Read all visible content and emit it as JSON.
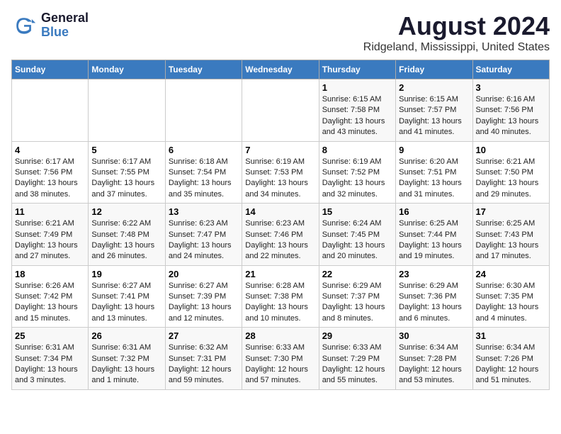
{
  "logo": {
    "line1": "General",
    "line2": "Blue"
  },
  "title": "August 2024",
  "subtitle": "Ridgeland, Mississippi, United States",
  "days_of_week": [
    "Sunday",
    "Monday",
    "Tuesday",
    "Wednesday",
    "Thursday",
    "Friday",
    "Saturday"
  ],
  "weeks": [
    [
      {
        "day": "",
        "info": ""
      },
      {
        "day": "",
        "info": ""
      },
      {
        "day": "",
        "info": ""
      },
      {
        "day": "",
        "info": ""
      },
      {
        "day": "1",
        "info": "Sunrise: 6:15 AM\nSunset: 7:58 PM\nDaylight: 13 hours\nand 43 minutes."
      },
      {
        "day": "2",
        "info": "Sunrise: 6:15 AM\nSunset: 7:57 PM\nDaylight: 13 hours\nand 41 minutes."
      },
      {
        "day": "3",
        "info": "Sunrise: 6:16 AM\nSunset: 7:56 PM\nDaylight: 13 hours\nand 40 minutes."
      }
    ],
    [
      {
        "day": "4",
        "info": "Sunrise: 6:17 AM\nSunset: 7:56 PM\nDaylight: 13 hours\nand 38 minutes."
      },
      {
        "day": "5",
        "info": "Sunrise: 6:17 AM\nSunset: 7:55 PM\nDaylight: 13 hours\nand 37 minutes."
      },
      {
        "day": "6",
        "info": "Sunrise: 6:18 AM\nSunset: 7:54 PM\nDaylight: 13 hours\nand 35 minutes."
      },
      {
        "day": "7",
        "info": "Sunrise: 6:19 AM\nSunset: 7:53 PM\nDaylight: 13 hours\nand 34 minutes."
      },
      {
        "day": "8",
        "info": "Sunrise: 6:19 AM\nSunset: 7:52 PM\nDaylight: 13 hours\nand 32 minutes."
      },
      {
        "day": "9",
        "info": "Sunrise: 6:20 AM\nSunset: 7:51 PM\nDaylight: 13 hours\nand 31 minutes."
      },
      {
        "day": "10",
        "info": "Sunrise: 6:21 AM\nSunset: 7:50 PM\nDaylight: 13 hours\nand 29 minutes."
      }
    ],
    [
      {
        "day": "11",
        "info": "Sunrise: 6:21 AM\nSunset: 7:49 PM\nDaylight: 13 hours\nand 27 minutes."
      },
      {
        "day": "12",
        "info": "Sunrise: 6:22 AM\nSunset: 7:48 PM\nDaylight: 13 hours\nand 26 minutes."
      },
      {
        "day": "13",
        "info": "Sunrise: 6:23 AM\nSunset: 7:47 PM\nDaylight: 13 hours\nand 24 minutes."
      },
      {
        "day": "14",
        "info": "Sunrise: 6:23 AM\nSunset: 7:46 PM\nDaylight: 13 hours\nand 22 minutes."
      },
      {
        "day": "15",
        "info": "Sunrise: 6:24 AM\nSunset: 7:45 PM\nDaylight: 13 hours\nand 20 minutes."
      },
      {
        "day": "16",
        "info": "Sunrise: 6:25 AM\nSunset: 7:44 PM\nDaylight: 13 hours\nand 19 minutes."
      },
      {
        "day": "17",
        "info": "Sunrise: 6:25 AM\nSunset: 7:43 PM\nDaylight: 13 hours\nand 17 minutes."
      }
    ],
    [
      {
        "day": "18",
        "info": "Sunrise: 6:26 AM\nSunset: 7:42 PM\nDaylight: 13 hours\nand 15 minutes."
      },
      {
        "day": "19",
        "info": "Sunrise: 6:27 AM\nSunset: 7:41 PM\nDaylight: 13 hours\nand 13 minutes."
      },
      {
        "day": "20",
        "info": "Sunrise: 6:27 AM\nSunset: 7:39 PM\nDaylight: 13 hours\nand 12 minutes."
      },
      {
        "day": "21",
        "info": "Sunrise: 6:28 AM\nSunset: 7:38 PM\nDaylight: 13 hours\nand 10 minutes."
      },
      {
        "day": "22",
        "info": "Sunrise: 6:29 AM\nSunset: 7:37 PM\nDaylight: 13 hours\nand 8 minutes."
      },
      {
        "day": "23",
        "info": "Sunrise: 6:29 AM\nSunset: 7:36 PM\nDaylight: 13 hours\nand 6 minutes."
      },
      {
        "day": "24",
        "info": "Sunrise: 6:30 AM\nSunset: 7:35 PM\nDaylight: 13 hours\nand 4 minutes."
      }
    ],
    [
      {
        "day": "25",
        "info": "Sunrise: 6:31 AM\nSunset: 7:34 PM\nDaylight: 13 hours\nand 3 minutes."
      },
      {
        "day": "26",
        "info": "Sunrise: 6:31 AM\nSunset: 7:32 PM\nDaylight: 13 hours\nand 1 minute."
      },
      {
        "day": "27",
        "info": "Sunrise: 6:32 AM\nSunset: 7:31 PM\nDaylight: 12 hours\nand 59 minutes."
      },
      {
        "day": "28",
        "info": "Sunrise: 6:33 AM\nSunset: 7:30 PM\nDaylight: 12 hours\nand 57 minutes."
      },
      {
        "day": "29",
        "info": "Sunrise: 6:33 AM\nSunset: 7:29 PM\nDaylight: 12 hours\nand 55 minutes."
      },
      {
        "day": "30",
        "info": "Sunrise: 6:34 AM\nSunset: 7:28 PM\nDaylight: 12 hours\nand 53 minutes."
      },
      {
        "day": "31",
        "info": "Sunrise: 6:34 AM\nSunset: 7:26 PM\nDaylight: 12 hours\nand 51 minutes."
      }
    ]
  ]
}
